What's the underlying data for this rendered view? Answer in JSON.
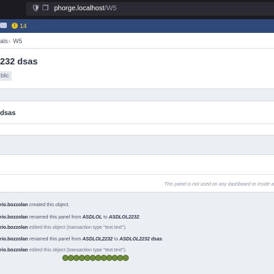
{
  "browser": {
    "host": "phorge.localhost",
    "path": "/W5"
  },
  "topbar": {
    "alert_count": "14"
  },
  "breadcrumb": {
    "parent": "als",
    "current": "W5",
    "separator": "›"
  },
  "header": {
    "title": "232 dsas",
    "policy": "blic"
  },
  "panel": {
    "title": "dsas"
  },
  "usage": {
    "note": "This panel is not used on any dashboard or inside a"
  },
  "timeline": [
    {
      "user": "rio.bozzolan",
      "text": " created this object."
    },
    {
      "user": "rio.bozzolan",
      "text1": " renamed this panel from ",
      "from": "ASDLOL",
      "text2": " to ",
      "to": "ASDLOL2232",
      "text3": "."
    },
    {
      "user": "rio.bozzolan",
      "text": " edited this object (transaction type \"text.text\")."
    },
    {
      "user": "rio.bozzolan",
      "text1": " renamed this panel from ",
      "from": "ASDLOL2232",
      "text2": " to ",
      "to": "ASDLOL2232 dsas",
      "text3": "."
    },
    {
      "user": "rio.bozzolan",
      "text": " edited this object (transaction type \"text.text\")."
    }
  ],
  "colors": {
    "topbar": "#2f4a7a",
    "loader": "#6f8e3a"
  }
}
